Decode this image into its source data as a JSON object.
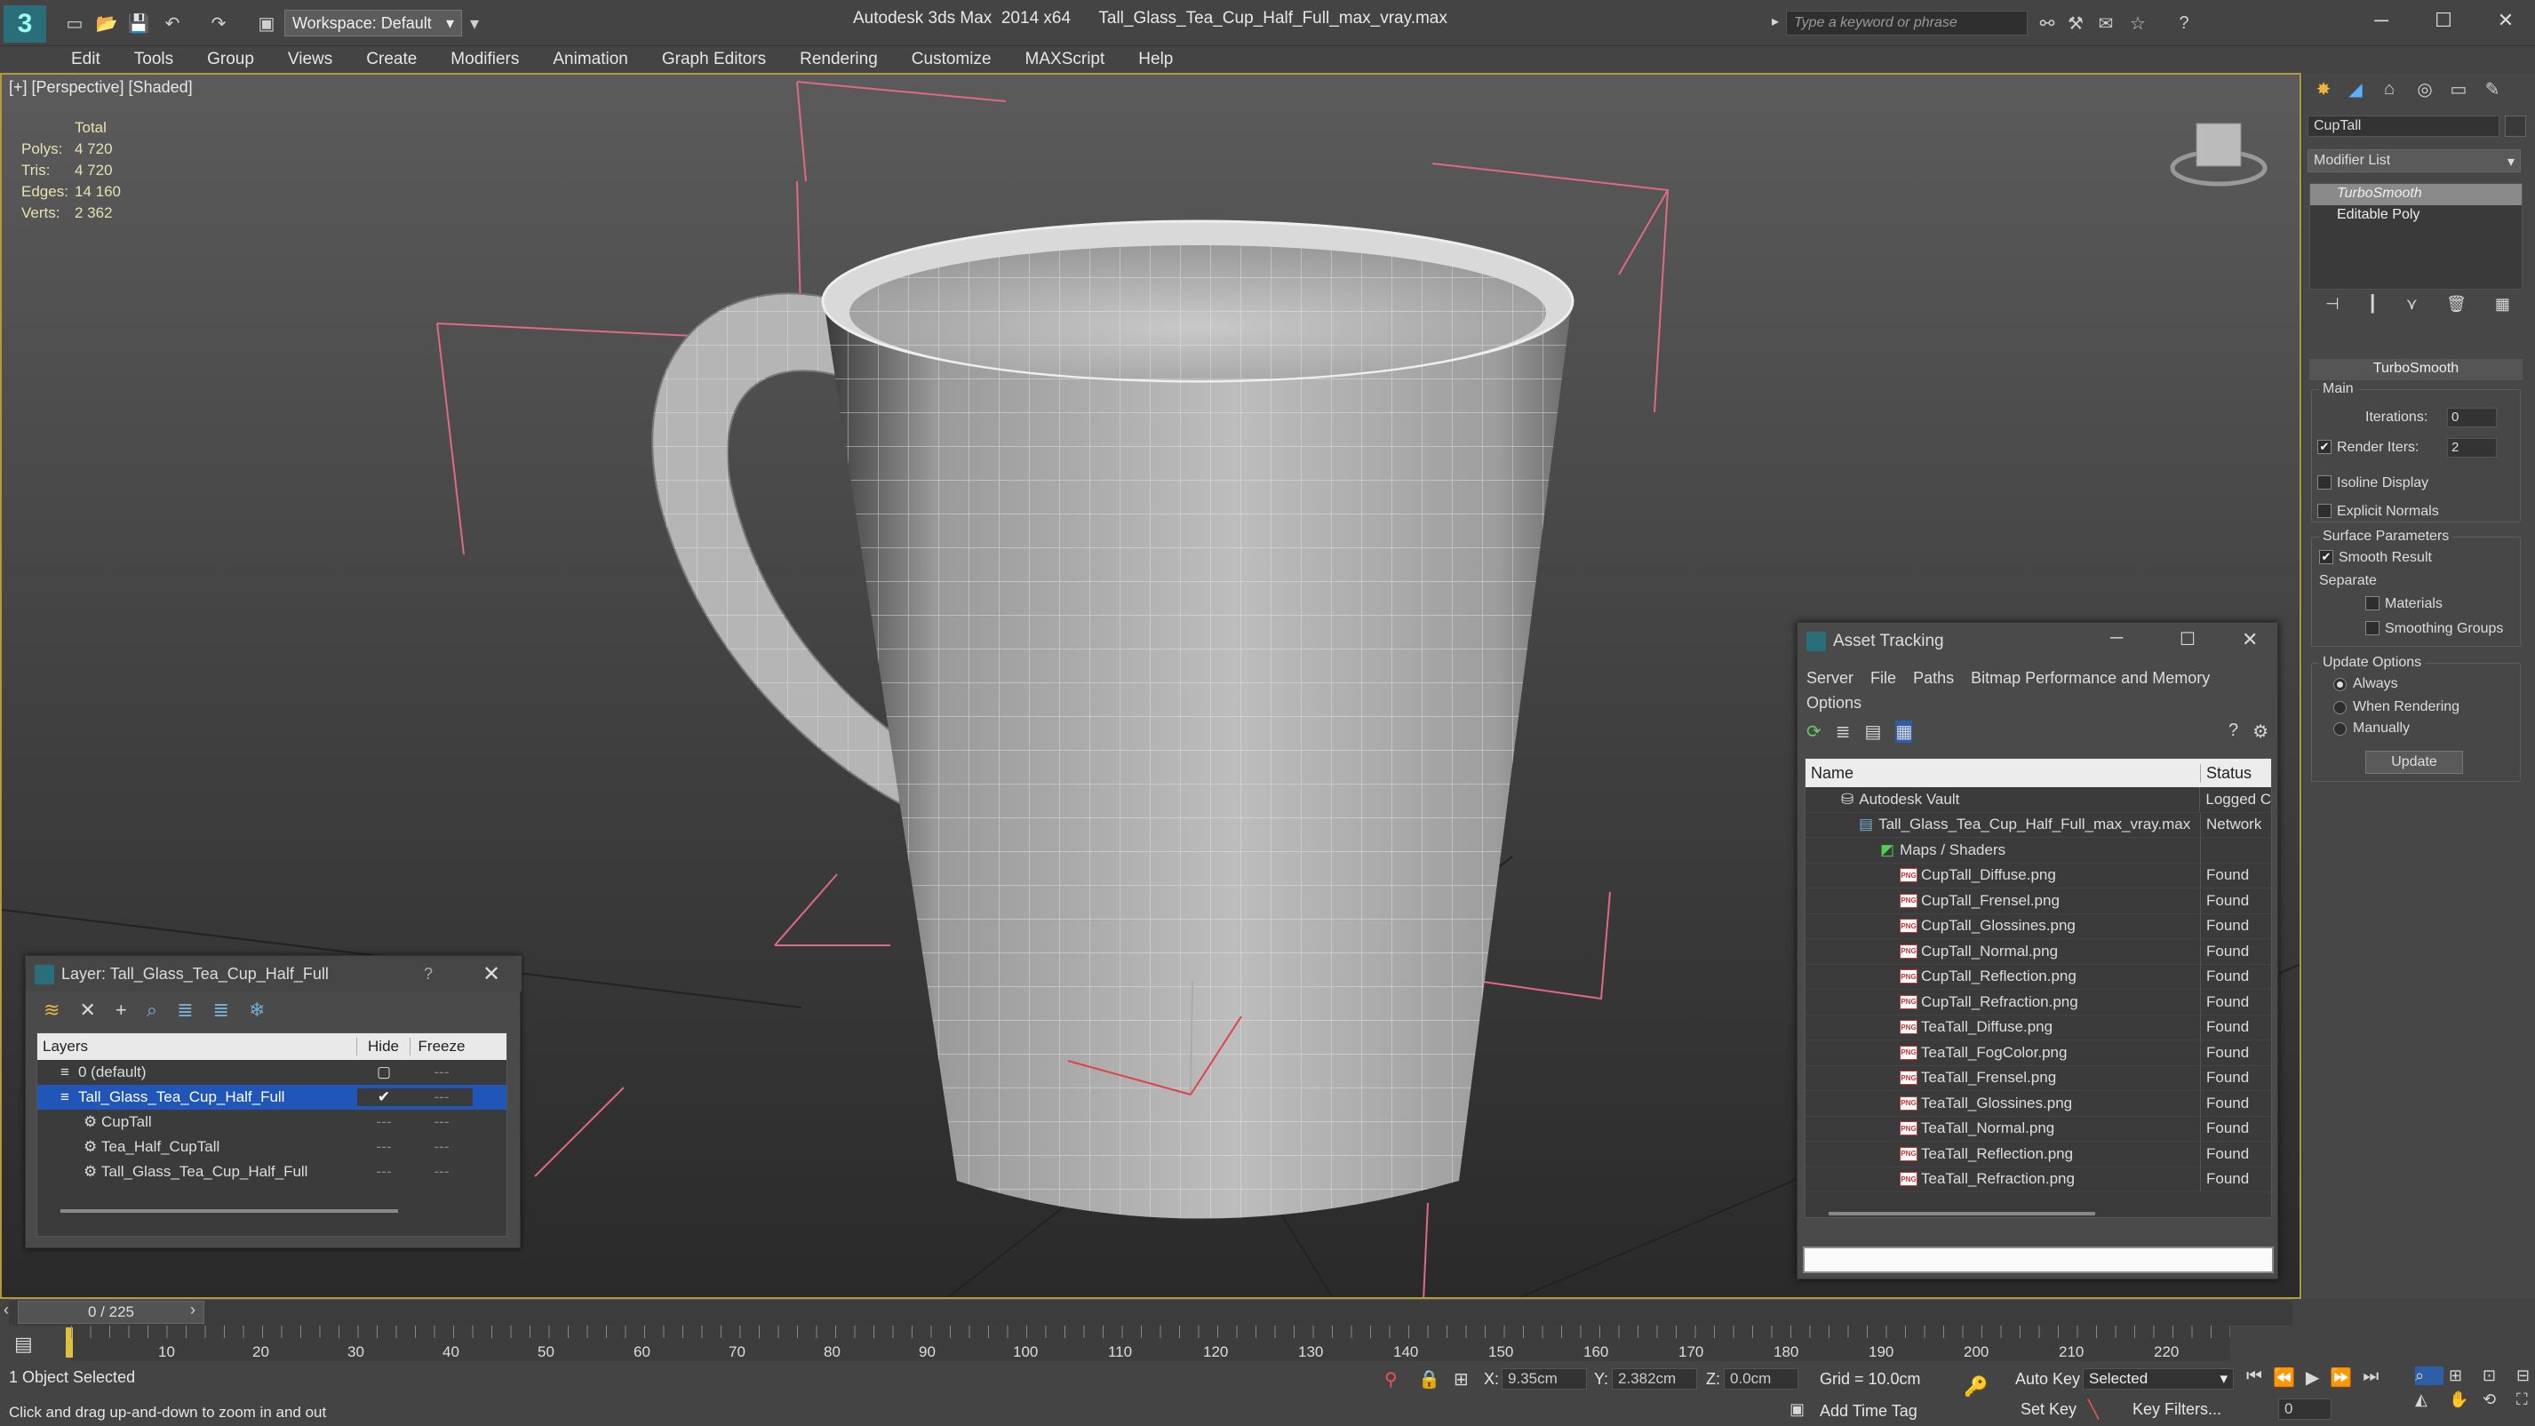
{
  "app": {
    "title": "Autodesk 3ds Max  2014 x64",
    "file": "Tall_Glass_Tea_Cup_Half_Full_max_vray.max",
    "workspace": "Workspace: Default",
    "search_placeholder": "Type a keyword or phrase"
  },
  "menu": [
    "Edit",
    "Tools",
    "Group",
    "Views",
    "Create",
    "Modifiers",
    "Animation",
    "Graph Editors",
    "Rendering",
    "Customize",
    "MAXScript",
    "Help"
  ],
  "viewport": {
    "label": "[+] [Perspective] [Shaded]",
    "stats_header": "Total",
    "stats": [
      {
        "k": "Polys:",
        "v": "4 720"
      },
      {
        "k": "Tris:",
        "v": "4 720"
      },
      {
        "k": "Edges:",
        "v": "14 160"
      },
      {
        "k": "Verts:",
        "v": "2 362"
      }
    ]
  },
  "command_panel": {
    "object_name": "CupTall",
    "modifier_list": "Modifier List",
    "stack": [
      "TurboSmooth",
      "Editable Poly"
    ],
    "rollout": "TurboSmooth",
    "main": "Main",
    "iterations_label": "Iterations:",
    "iterations": "0",
    "render_iters_label": "Render Iters:",
    "render_iters": "2",
    "isoline": "Isoline Display",
    "explicit": "Explicit Normals",
    "surface": "Surface Parameters",
    "smooth_result": "Smooth Result",
    "separate": "Separate",
    "materials": "Materials",
    "smoothing_groups": "Smoothing Groups",
    "update_options": "Update Options",
    "always": "Always",
    "when_rendering": "When Rendering",
    "manually": "Manually",
    "update": "Update"
  },
  "layer_dialog": {
    "title": "Layer: Tall_Glass_Tea_Cup_Half_Full",
    "help": "?",
    "col_layers": "Layers",
    "col_hide": "Hide",
    "col_freeze": "Freeze",
    "rows": [
      {
        "name": "0 (default)"
      },
      {
        "name": "Tall_Glass_Tea_Cup_Half_Full"
      },
      {
        "name": "CupTall"
      },
      {
        "name": "Tea_Half_CupTall"
      },
      {
        "name": "Tall_Glass_Tea_Cup_Half_Full"
      }
    ]
  },
  "asset_dialog": {
    "title": "Asset Tracking",
    "menu1": [
      "Server",
      "File",
      "Paths",
      "Bitmap Performance and Memory"
    ],
    "menu2": "Options",
    "col_name": "Name",
    "col_status": "Status",
    "rows": [
      {
        "name": "Autodesk Vault",
        "status": "Logged C"
      },
      {
        "name": "Tall_Glass_Tea_Cup_Half_Full_max_vray.max",
        "status": "Network"
      },
      {
        "name": "Maps / Shaders",
        "status": ""
      },
      {
        "name": "CupTall_Diffuse.png",
        "status": "Found"
      },
      {
        "name": "CupTall_Frensel.png",
        "status": "Found"
      },
      {
        "name": "CupTall_Glossines.png",
        "status": "Found"
      },
      {
        "name": "CupTall_Normal.png",
        "status": "Found"
      },
      {
        "name": "CupTall_Reflection.png",
        "status": "Found"
      },
      {
        "name": "CupTall_Refraction.png",
        "status": "Found"
      },
      {
        "name": "TeaTall_Diffuse.png",
        "status": "Found"
      },
      {
        "name": "TeaTall_FogColor.png",
        "status": "Found"
      },
      {
        "name": "TeaTall_Frensel.png",
        "status": "Found"
      },
      {
        "name": "TeaTall_Glossines.png",
        "status": "Found"
      },
      {
        "name": "TeaTall_Normal.png",
        "status": "Found"
      },
      {
        "name": "TeaTall_Reflection.png",
        "status": "Found"
      },
      {
        "name": "TeaTall_Refraction.png",
        "status": "Found"
      }
    ]
  },
  "timeline": {
    "frame": "0 / 225",
    "ticks": [
      "10",
      "20",
      "30",
      "40",
      "50",
      "60",
      "70",
      "80",
      "90",
      "100",
      "110",
      "120",
      "130",
      "140",
      "150",
      "160",
      "170",
      "180",
      "190",
      "200",
      "210",
      "220"
    ]
  },
  "status": {
    "selected": "1 Object Selected",
    "hint": "Click and drag up-and-down to zoom in and out",
    "x_label": "X:",
    "x": "9.35cm",
    "y_label": "Y:",
    "y": "2.382cm",
    "z_label": "Z:",
    "z": "0.0cm",
    "grid": "Grid = 10.0cm",
    "auto_key": "Auto Key",
    "set_key": "Set Key",
    "selected_dd": "Selected",
    "key_filters": "Key Filters...",
    "add_time_tag": "Add Time Tag",
    "frame_field": "0"
  }
}
